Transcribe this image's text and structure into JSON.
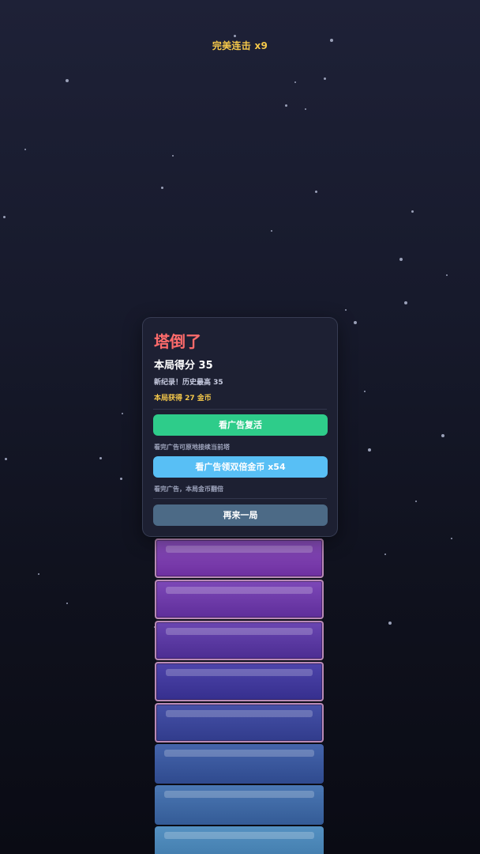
{
  "hud": {
    "combo_text": "完美连击 x9"
  },
  "game_over": {
    "title": "塔倒了",
    "score_text": "本局得分 35",
    "record_text": "新纪录！历史最高 35",
    "coins_text": "本局获得 27 金币",
    "revive_button": "看广告复活",
    "revive_hint": "看完广告可原地接续当前塔",
    "double_button": "看广告领双倍金币 x54",
    "double_hint": "看完广告，本局金币翻倍",
    "replay_button": "再来一局"
  },
  "colors": {
    "combo": "#f5c84a",
    "title": "#ff6b6b",
    "revive_button": "#2ecc8a",
    "double_button": "#58bff5",
    "replay_button": "#4c6a86"
  }
}
